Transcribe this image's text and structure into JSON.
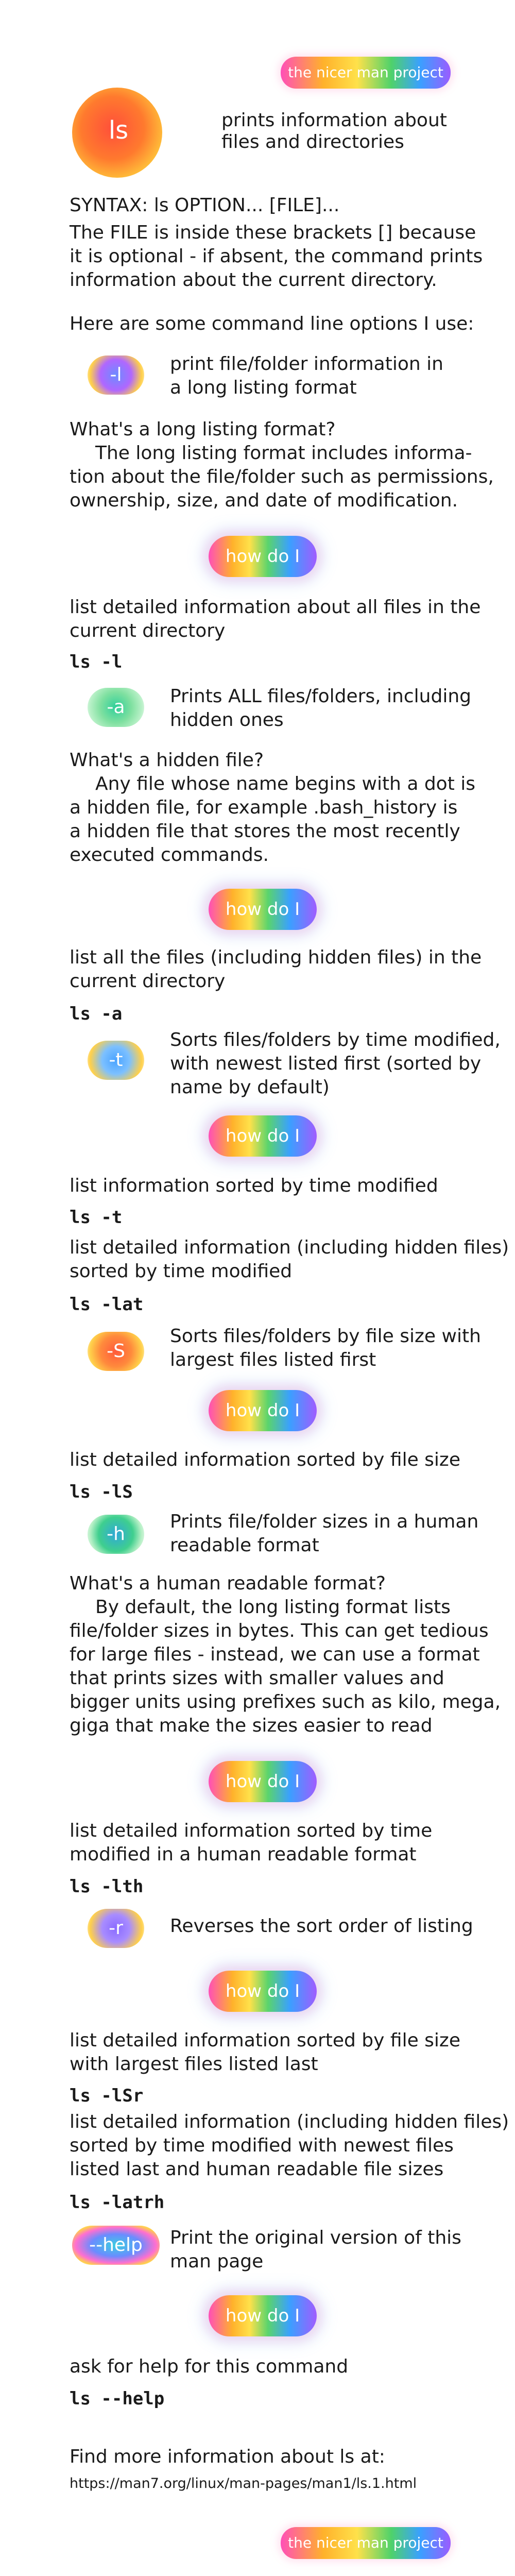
{
  "brand": {
    "top": "the nicer man project",
    "bottom": "the nicer man project"
  },
  "header": {
    "command": "ls",
    "description_1": "prints information about",
    "description_2": "files and directories"
  },
  "syntax": {
    "line": "SYNTAX: ls OPTION... [FILE]...",
    "explain_1": "The FILE is inside these brackets [] because",
    "explain_2": "it is optional - if absent, the command prints",
    "explain_3": "information about the current directory."
  },
  "intro": "Here are some command line options I use:",
  "how_do_i": "how do I",
  "options": {
    "l": {
      "badge": "-l",
      "desc_1": "print file/folder information in",
      "desc_2": "a long listing format"
    },
    "a": {
      "badge": "-a",
      "desc_1": "Prints ALL files/folders, including",
      "desc_2": "hidden ones"
    },
    "t": {
      "badge": "-t",
      "desc_1": "Sorts files/folders by time modified,",
      "desc_2": "with newest listed first (sorted by",
      "desc_3": "name by default)"
    },
    "S": {
      "badge": "-S",
      "desc_1": "Sorts files/folders by file size with",
      "desc_2": "largest files listed first"
    },
    "h": {
      "badge": "-h",
      "desc_1": "Prints file/folder sizes in a human",
      "desc_2": "readable format"
    },
    "r": {
      "badge": "-r",
      "desc_1": "Reverses the sort order of listing"
    },
    "help": {
      "badge": "--help",
      "desc_1": "Print the original version of this",
      "desc_2": "man page"
    }
  },
  "faq": {
    "long_q": "What's a long listing format?",
    "long_a_1": "The long listing format includes informa-",
    "long_a_2": "tion about the file/folder such as permissions,",
    "long_a_3": "ownership, size, and date of modification.",
    "hidden_q": "What's a hidden file?",
    "hidden_a_1": "Any file whose name begins with a dot is",
    "hidden_a_2": "a hidden file, for example .bash_history is",
    "hidden_a_3": "a hidden file that stores the most recently",
    "hidden_a_4": "executed commands.",
    "human_q": "What's a human readable format?",
    "human_a_1": "By default, the long listing format lists",
    "human_a_2": "file/folder sizes in bytes. This can get tedious",
    "human_a_3": "for large files - instead, we can use a format",
    "human_a_4": "that prints sizes with smaller values and",
    "human_a_5": "bigger units using prefixes such as kilo, mega,",
    "human_a_6": "giga that make the sizes easier to read"
  },
  "examples": {
    "e1": {
      "task_1": "list detailed information about all files in the",
      "task_2": "current directory",
      "cmd": "ls -l"
    },
    "e2": {
      "task_1": "list all the files (including hidden files) in the",
      "task_2": "current directory",
      "cmd": "ls -a"
    },
    "e3": {
      "task_1": "list information sorted by time modified",
      "cmd": "ls -t"
    },
    "e4": {
      "task_1": "list detailed information (including hidden files)",
      "task_2": "sorted by time modified",
      "cmd": "ls -lat"
    },
    "e5": {
      "task_1": "list detailed information sorted by file size",
      "cmd": "ls -lS"
    },
    "e6": {
      "task_1": "list detailed information sorted by time",
      "task_2": "modified in a human readable format",
      "cmd": "ls -lth"
    },
    "e7": {
      "task_1": "list detailed information sorted by file size",
      "task_2": "with largest files listed last",
      "cmd": "ls -lSr"
    },
    "e8": {
      "task_1": "list detailed information (including hidden files)",
      "task_2": "sorted by time modified with newest files",
      "task_3": "listed last and human readable file sizes",
      "cmd": "ls -latrh"
    },
    "e9": {
      "task_1": "ask for help for this command",
      "cmd": "ls --help"
    }
  },
  "footer": {
    "more": "Find more information about ls at:",
    "url": "https://man7.org/linux/man-pages/man1/ls.1.html"
  },
  "colors": {
    "ls_orange": "#ff7a2e",
    "l_blue": "#6b8cff",
    "a_green": "#3fcf8e",
    "t_blue": "#4aa3ff",
    "S_orange": "#ff5a3c",
    "h_teal": "#2fa8d8",
    "r_purple": "#8a6bff",
    "help_cyan": "#3ccfe0"
  }
}
